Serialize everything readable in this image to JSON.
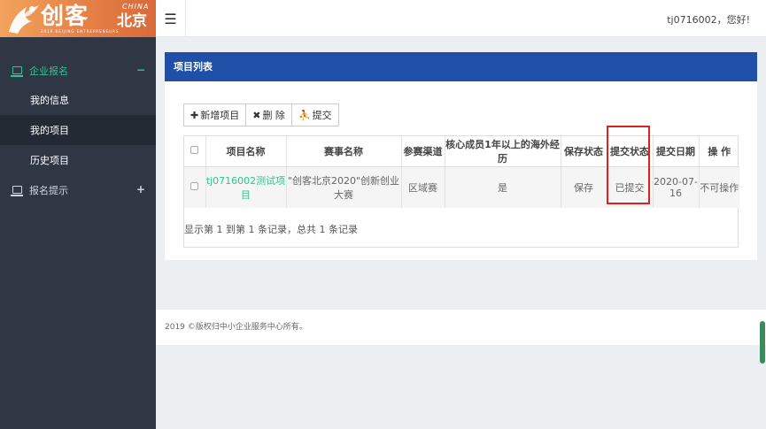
{
  "logo": {
    "main": "创客",
    "city": "北京",
    "china": "CHINA",
    "sub": "2019 BEIJING ENTREPRENEURS"
  },
  "header": {
    "greeting": "tj0716002，您好!"
  },
  "sidebar": {
    "groups": [
      {
        "label": "企业报名",
        "toggle": "−",
        "items": [
          "我的信息",
          "我的项目",
          "历史项目"
        ]
      },
      {
        "label": "报名提示",
        "toggle": "+"
      }
    ]
  },
  "panel": {
    "title": "项目列表",
    "toolbar": {
      "add": "新增项目",
      "delete": "删 除",
      "submit": "提交"
    },
    "table": {
      "headers": [
        "项目名称",
        "赛事名称",
        "参赛渠道",
        "核心成员1年以上的海外经历",
        "保存状态",
        "提交状态",
        "提交日期",
        "操 作"
      ],
      "rows": [
        [
          "tj0716002测试项目",
          "\"创客北京2020\"创新创业大赛",
          "区域赛",
          "是",
          "保存",
          "已提交",
          "2020-07-16",
          "不可操作"
        ]
      ]
    },
    "pagination": "显示第 1 到第 1 条记录，总共 1 条记录"
  },
  "footer": {
    "text": "2019 ©版权归中小企业服务中心所有。"
  },
  "colors": {
    "sidebar": "#2f3744",
    "accent": "#2fc592",
    "panel_header": "#1f4fa6",
    "highlight": "#e02020"
  }
}
